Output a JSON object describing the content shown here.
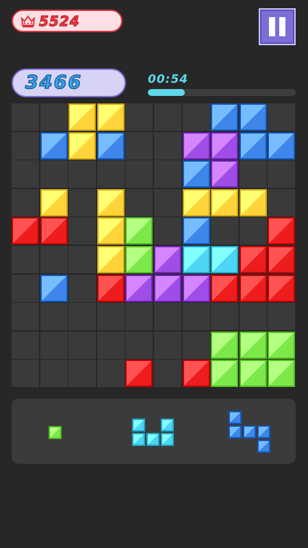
{
  "header": {
    "best_score": "5524",
    "crown_icon": "crown-icon",
    "pause_icon": "pause-icon"
  },
  "status": {
    "score": "3466",
    "timer": "00:54",
    "timer_progress": 0.25
  },
  "colors": {
    "yellow": "#ffd43a",
    "blue": "#3f86ea",
    "purple": "#9e4ee6",
    "red": "#ee1c1c",
    "green": "#7ce84a",
    "cyan": "#4cd5f4",
    "empty": "#3a3a3a"
  },
  "board": {
    "rows": [
      [
        ".",
        ".",
        "Y",
        "Y",
        ".",
        ".",
        ".",
        "B",
        "B",
        "."
      ],
      [
        ".",
        "B",
        "Y",
        "B",
        ".",
        ".",
        "P",
        "P",
        "B",
        "B"
      ],
      [
        ".",
        ".",
        ".",
        ".",
        ".",
        ".",
        "B",
        "P",
        ".",
        "."
      ],
      [
        ".",
        "Y",
        ".",
        "Y",
        ".",
        ".",
        "Y",
        "Y",
        "Y",
        "."
      ],
      [
        "R",
        "R",
        ".",
        "Y",
        "G",
        ".",
        "B",
        ".",
        ".",
        "R"
      ],
      [
        ".",
        ".",
        ".",
        "Y",
        "G",
        "P",
        "C",
        "C",
        "R",
        "R"
      ],
      [
        ".",
        "B",
        ".",
        "R",
        "P",
        "P",
        "P",
        "R",
        "R",
        "R"
      ],
      [
        ".",
        ".",
        ".",
        ".",
        ".",
        ".",
        ".",
        ".",
        ".",
        "."
      ],
      [
        ".",
        ".",
        ".",
        ".",
        ".",
        ".",
        ".",
        "G",
        "G",
        "G"
      ],
      [
        ".",
        ".",
        ".",
        ".",
        "R",
        ".",
        "R",
        "G",
        "G",
        "G"
      ]
    ]
  },
  "tray": {
    "pieces": [
      {
        "name": "piece-single-green",
        "color": "G",
        "cells": [
          [
            0,
            0
          ]
        ]
      },
      {
        "name": "piece-u-cyan",
        "color": "C",
        "cells": [
          [
            0,
            0
          ],
          [
            0,
            2
          ],
          [
            1,
            0
          ],
          [
            1,
            1
          ],
          [
            1,
            2
          ]
        ]
      },
      {
        "name": "piece-z-blue",
        "color": "B",
        "cells": [
          [
            0,
            0
          ],
          [
            1,
            0
          ],
          [
            1,
            1
          ],
          [
            1,
            2
          ],
          [
            2,
            2
          ]
        ]
      }
    ]
  }
}
